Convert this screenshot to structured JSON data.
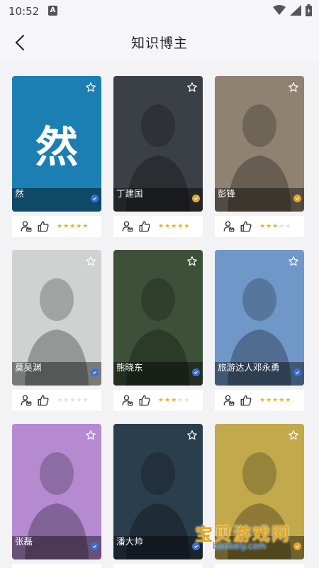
{
  "status": {
    "time": "10:52",
    "notice": "A"
  },
  "header": {
    "title": "知识博主"
  },
  "cards": [
    {
      "name": "然",
      "rating": 5,
      "badge": "blue",
      "bg": "#1b7fb3",
      "avatar_text": "然"
    },
    {
      "name": "丁建国",
      "rating": 5,
      "badge": "gold",
      "bg": "#3b3f46"
    },
    {
      "name": "彭锋",
      "rating": 3,
      "badge": "gold",
      "bg": "#8f8270"
    },
    {
      "name": "莫吴渊",
      "rating": 0,
      "badge": "blue",
      "bg": "#cfd2d1"
    },
    {
      "name": "熊晓东",
      "rating": 3,
      "badge": "blue",
      "bg": "#3d5138"
    },
    {
      "name": "旅游达人邓永勇",
      "rating": 5,
      "badge": "blue",
      "bg": "#6f98c9"
    },
    {
      "name": "张磊",
      "rating": 0,
      "badge": "blue",
      "bg": "#b58ad1"
    },
    {
      "name": "潘大帅",
      "rating": 0,
      "badge": "blue",
      "bg": "#2b3e4d"
    },
    {
      "name": "",
      "rating": 0,
      "badge": "gold",
      "bg": "#c2a94c"
    }
  ],
  "watermark": {
    "text": "宝贝游戏网",
    "domain": "baobeiy.com"
  },
  "colors": {
    "star_on": "#f2b416",
    "star_off": "#e2e2e2",
    "badge_blue": "#3a6fd8",
    "badge_gold": "#e9a52b"
  }
}
